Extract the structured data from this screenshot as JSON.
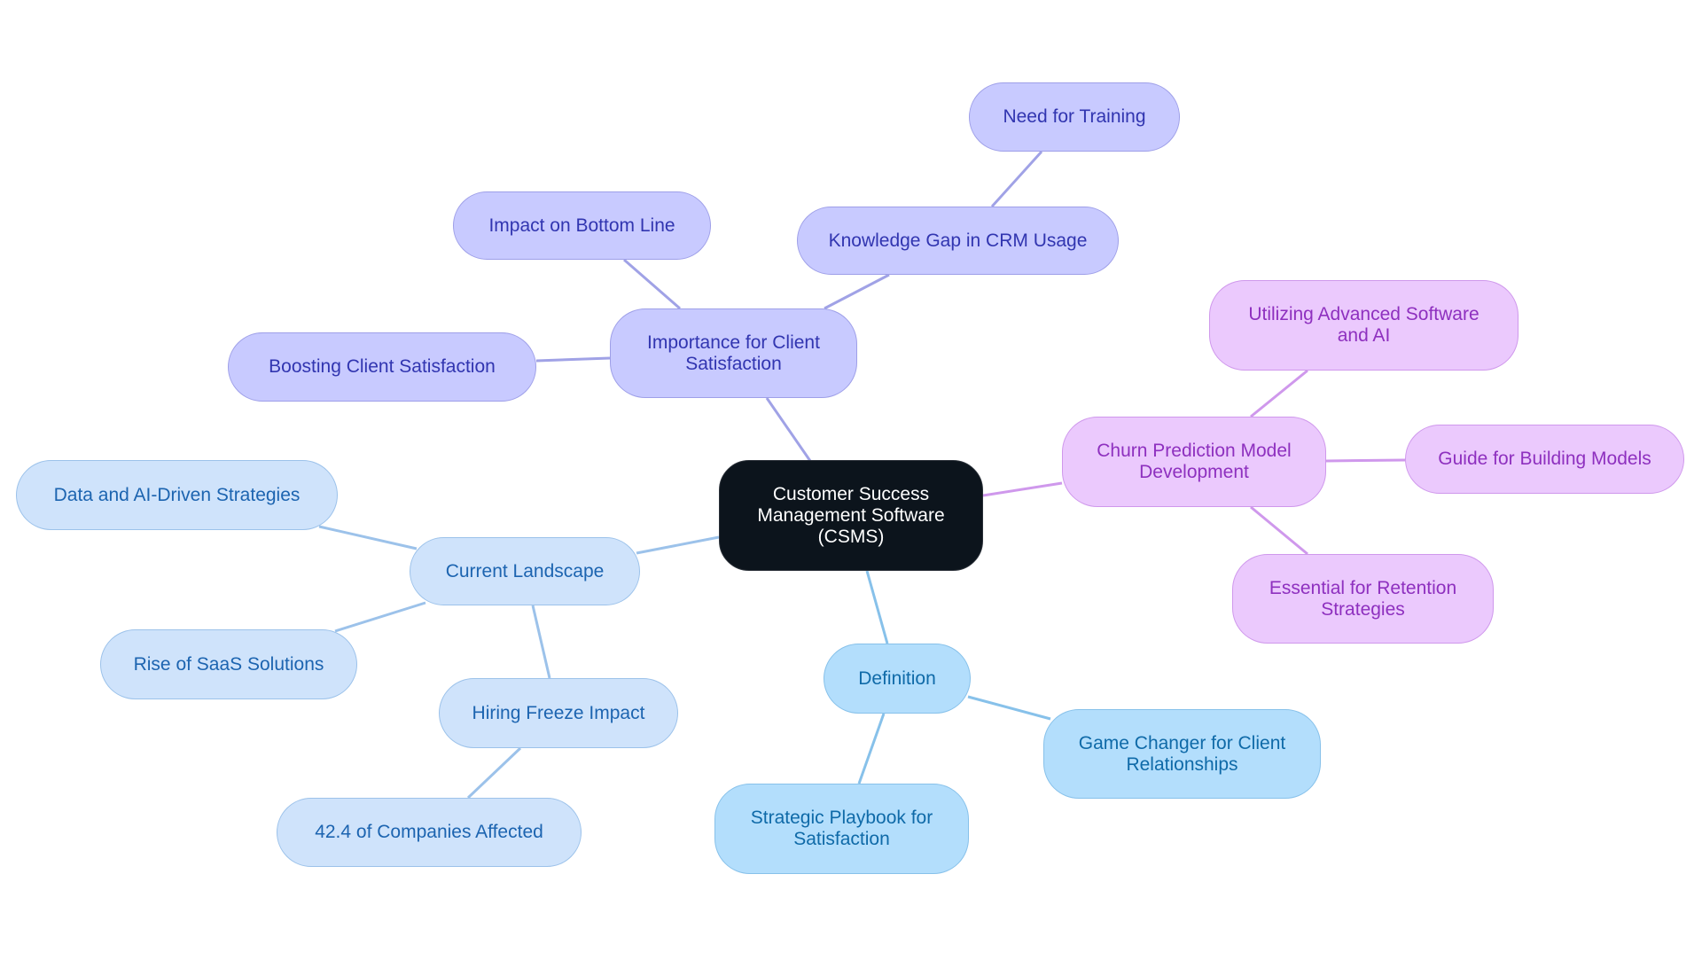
{
  "title": "Customer Success Management Software (CSMS) mind map",
  "colors": {
    "root_bg": "#0c141c",
    "indigo_edge": "#a0a2e6",
    "purple_edge": "#cf98ec",
    "lightblue_edge": "#9cc2ea",
    "skyblue_edge": "#87c1ea"
  },
  "root": {
    "label": "Customer Success Management Software (CSMS)"
  },
  "branches": [
    {
      "label": "Importance for Client Satisfaction",
      "children": [
        "Boosting Client Satisfaction",
        "Impact on Bottom Line",
        "Knowledge Gap in CRM Usage"
      ],
      "grandchildren": {
        "Knowledge Gap in CRM Usage": [
          "Need for Training"
        ]
      }
    },
    {
      "label": "Churn Prediction Model Development",
      "children": [
        "Utilizing Advanced Software and AI",
        "Guide for Building Models",
        "Essential for Retention Strategies"
      ]
    },
    {
      "label": "Current Landscape",
      "children": [
        "Data and AI-Driven Strategies",
        "Rise of SaaS Solutions",
        "Hiring Freeze Impact"
      ],
      "grandchildren": {
        "Hiring Freeze Impact": [
          "42.4 of Companies Affected"
        ]
      }
    },
    {
      "label": "Definition",
      "children": [
        "Game Changer for Client Relationships",
        "Strategic Playbook for Satisfaction"
      ]
    }
  ],
  "nodes": {
    "root": "Customer Success Management Software (CSMS)",
    "importance": "Importance for Client Satisfaction",
    "boosting": "Boosting Client Satisfaction",
    "impact": "Impact on Bottom Line",
    "knowledge": "Knowledge Gap in CRM Usage",
    "training": "Need for Training",
    "churn": "Churn Prediction Model Development",
    "utilizing": "Utilizing Advanced Software and AI",
    "guide": "Guide for Building Models",
    "essential": "Essential for Retention Strategies",
    "landscape": "Current Landscape",
    "dataai": "Data and AI-Driven Strategies",
    "saas": "Rise of SaaS Solutions",
    "hiring": "Hiring Freeze Impact",
    "companies": "42.4 of Companies Affected",
    "definition": "Definition",
    "gamechanger": "Game Changer for Client Relationships",
    "playbook": "Strategic Playbook for Satisfaction"
  }
}
